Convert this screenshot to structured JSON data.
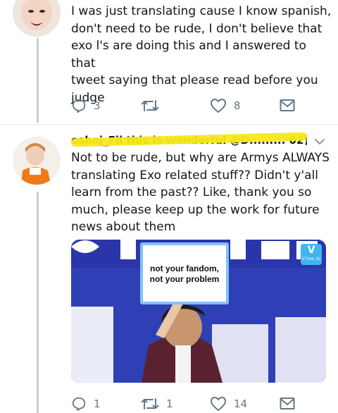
{
  "tweet1": {
    "text": "I was just translating cause I know spanish,\ndon't need to be rude, I don't believe that\nexo l's are doing this and I answered to that\ntweet saying that please read before you\njudge",
    "replies": "3",
    "retweets": "",
    "likes": "8"
  },
  "tweet2": {
    "handle": "oshaj_Fil this is wonderful @D.........  02월 02일",
    "text": "Not to be rude, but why are Armys ALWAYS\ntranslating Exo related stuff?? Didn't y'all\nlearn from the past?? Like, thank you so\nmuch, please keep up the work for future\nnews about them",
    "image": {
      "sign_text": "not your fandom,\nnot your problem",
      "watermark": "V",
      "watermark_sub": "V live .tv"
    },
    "replies": "1",
    "retweets": "1",
    "likes": "14"
  },
  "icons": {
    "reply": "reply-icon",
    "retweet": "retweet-icon",
    "like": "heart-icon",
    "dm": "mail-icon",
    "caret": "chevron-down-icon"
  },
  "colors": {
    "icon": "#657786",
    "highlight": "#f8e81a",
    "thread_line": "#c7d0d8"
  }
}
